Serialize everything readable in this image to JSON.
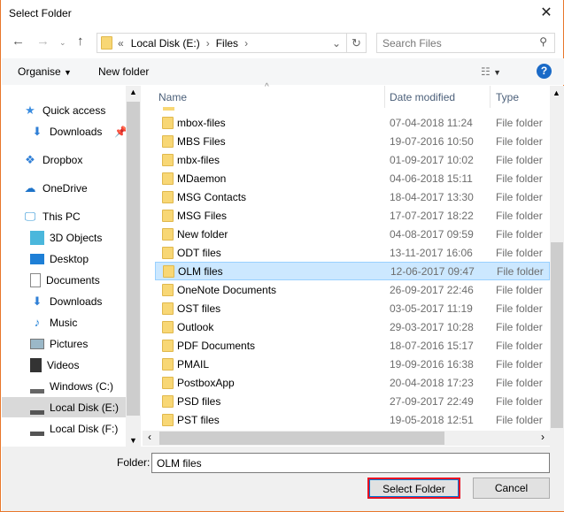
{
  "title": "Select Folder",
  "address": {
    "prefix": "«",
    "crumbs": [
      "Local Disk (E:)",
      "Files"
    ]
  },
  "search": {
    "placeholder": "Search Files"
  },
  "toolbar": {
    "organise": "Organise",
    "new_folder": "New folder"
  },
  "sidebar": {
    "items": [
      {
        "label": "Quick access",
        "icon": "star-icon"
      },
      {
        "label": "Downloads",
        "icon": "download-icon"
      },
      {
        "label": "Dropbox",
        "icon": "dropbox-icon"
      },
      {
        "label": "OneDrive",
        "icon": "cloud-icon"
      },
      {
        "label": "This PC",
        "icon": "computer-icon"
      },
      {
        "label": "3D Objects",
        "icon": "cube-icon"
      },
      {
        "label": "Desktop",
        "icon": "desktop-icon"
      },
      {
        "label": "Documents",
        "icon": "document-icon"
      },
      {
        "label": "Downloads",
        "icon": "download-icon"
      },
      {
        "label": "Music",
        "icon": "music-icon"
      },
      {
        "label": "Pictures",
        "icon": "pictures-icon"
      },
      {
        "label": "Videos",
        "icon": "videos-icon"
      },
      {
        "label": "Windows (C:)",
        "icon": "drive-icon"
      },
      {
        "label": "Local Disk (E:)",
        "icon": "drive-icon",
        "selected": true
      },
      {
        "label": "Local Disk (F:)",
        "icon": "drive-icon"
      }
    ]
  },
  "columns": {
    "name": "Name",
    "date": "Date modified",
    "type": "Type"
  },
  "files": [
    {
      "name": "mbox-files",
      "date": "07-04-2018 11:24",
      "type": "File folder"
    },
    {
      "name": "MBS Files",
      "date": "19-07-2016 10:50",
      "type": "File folder"
    },
    {
      "name": "mbx-files",
      "date": "01-09-2017 10:02",
      "type": "File folder"
    },
    {
      "name": "MDaemon",
      "date": "04-06-2018 15:11",
      "type": "File folder"
    },
    {
      "name": "MSG Contacts",
      "date": "18-04-2017 13:30",
      "type": "File folder"
    },
    {
      "name": "MSG Files",
      "date": "17-07-2017 18:22",
      "type": "File folder"
    },
    {
      "name": "New folder",
      "date": "04-08-2017 09:59",
      "type": "File folder"
    },
    {
      "name": "ODT files",
      "date": "13-11-2017 16:06",
      "type": "File folder"
    },
    {
      "name": "OLM files",
      "date": "12-06-2017 09:47",
      "type": "File folder",
      "selected": true
    },
    {
      "name": "OneNote Documents",
      "date": "26-09-2017 22:46",
      "type": "File folder"
    },
    {
      "name": "OST files",
      "date": "03-05-2017 11:19",
      "type": "File folder"
    },
    {
      "name": "Outlook",
      "date": "29-03-2017 10:28",
      "type": "File folder"
    },
    {
      "name": "PDF Documents",
      "date": "18-07-2016 15:17",
      "type": "File folder"
    },
    {
      "name": "PMAIL",
      "date": "19-09-2016 16:38",
      "type": "File folder"
    },
    {
      "name": "PostboxApp",
      "date": "20-04-2018 17:23",
      "type": "File folder"
    },
    {
      "name": "PSD files",
      "date": "27-09-2017 22:49",
      "type": "File folder"
    },
    {
      "name": "PST files",
      "date": "19-05-2018 12:51",
      "type": "File folder"
    }
  ],
  "footer": {
    "folder_label": "Folder:",
    "folder_value": "OLM files",
    "select": "Select Folder",
    "cancel": "Cancel"
  },
  "colors": {
    "accent_border": "#e8772b",
    "selection": "#cce8ff",
    "primary_button_border": "#e81123"
  }
}
